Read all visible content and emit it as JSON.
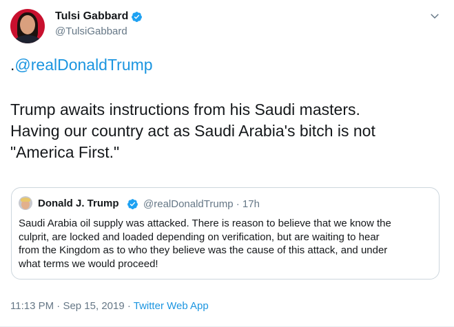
{
  "author": {
    "display_name": "Tulsi Gabbard",
    "handle": "@TulsiGabbard",
    "verified": true
  },
  "tweet": {
    "prefix": ".",
    "mention": "@realDonaldTrump",
    "text_lines": [
      "Trump awaits instructions from his Saudi masters.",
      "Having our country act as Saudi Arabia's bitch is not",
      "\"America First.\""
    ]
  },
  "quoted_tweet": {
    "display_name": "Donald J. Trump",
    "handle": "@realDonaldTrump",
    "separator": "·",
    "time_ago": "17h",
    "verified": true,
    "text_lines": [
      "Saudi Arabia oil supply was attacked. There is reason to believe that we know the",
      "culprit, are locked and loaded depending on verification, but are waiting to hear",
      "from the Kingdom as to who they believe was the cause of this attack, and under",
      "what terms we would proceed!"
    ]
  },
  "footer": {
    "time": "11:13 PM",
    "separator": "·",
    "date": "Sep 15, 2019",
    "source": "Twitter Web App"
  },
  "icons": {
    "verified": "verified-badge-icon",
    "more": "chevron-down-icon"
  },
  "colors": {
    "link_blue": "#1b95e0",
    "verified_blue": "#1da1f2",
    "secondary_text": "#657786",
    "primary_text": "#14171a",
    "border": "#ccd6dd"
  }
}
